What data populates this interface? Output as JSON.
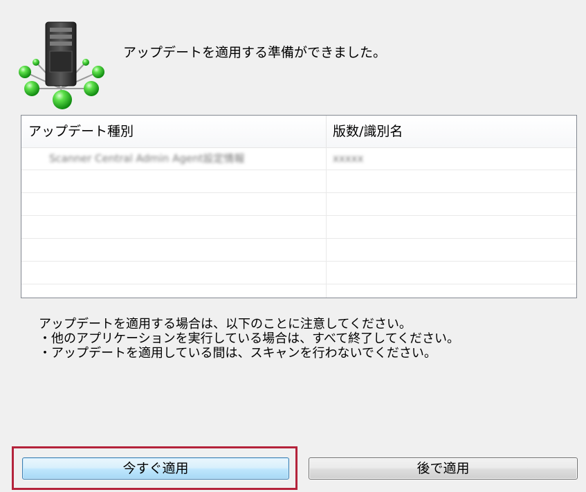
{
  "header": {
    "icon": "server-network-icon",
    "message": "アップデートを適用する準備ができました。"
  },
  "list": {
    "columns": [
      "アップデート種別",
      "版数/識別名"
    ],
    "rows": [
      [
        "Scanner Central Admin Agent設定情報",
        "xxxxx"
      ],
      [
        "",
        ""
      ],
      [
        "",
        ""
      ],
      [
        "",
        ""
      ],
      [
        "",
        ""
      ],
      [
        "",
        ""
      ],
      [
        "",
        ""
      ]
    ]
  },
  "notes": {
    "line1": "アップデートを適用する場合は、以下のことに注意してください。",
    "line2": "・他のアプリケーションを実行している場合は、すべて終了してください。",
    "line3": "・アップデートを適用している間は、スキャンを行わないでください。"
  },
  "buttons": {
    "apply_now": "今すぐ適用",
    "apply_later": "後で適用"
  },
  "colors": {
    "highlight": "#b4233b",
    "node_green": "#2ecc40",
    "server_dark": "#3a3a3a"
  }
}
